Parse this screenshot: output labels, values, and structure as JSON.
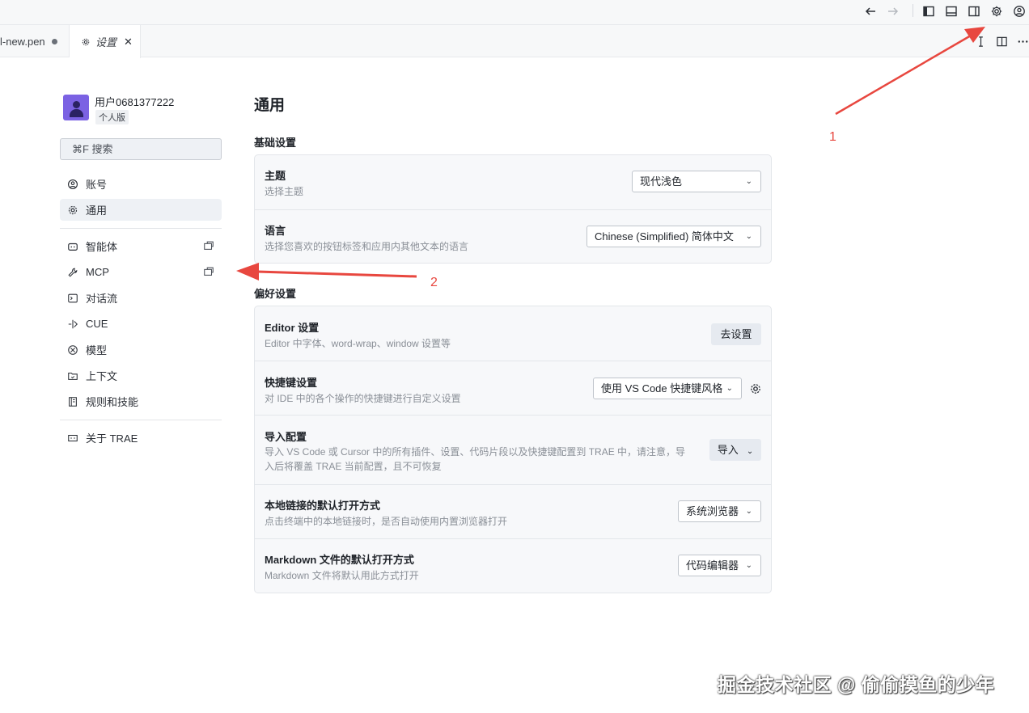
{
  "tabs": {
    "inactive_label": "l-new.pen",
    "active_label": "设置",
    "close_glyph": "✕"
  },
  "sidebar": {
    "username": "用户0681377222",
    "plan": "个人版",
    "search_label": "⌘F 搜索",
    "items": [
      {
        "label": "账号",
        "icon": "account-circle-icon"
      },
      {
        "label": "通用",
        "icon": "gear-icon"
      },
      {
        "label": "智能体",
        "icon": "agent-icon"
      },
      {
        "label": "MCP",
        "icon": "wrench-icon"
      },
      {
        "label": "对话流",
        "icon": "chat-flow-icon"
      },
      {
        "label": "CUE",
        "icon": "cue-icon"
      },
      {
        "label": "模型",
        "icon": "model-icon"
      },
      {
        "label": "上下文",
        "icon": "context-folder-icon"
      },
      {
        "label": "规则和技能",
        "icon": "rules-book-icon"
      },
      {
        "label": "关于 TRAE",
        "icon": "about-icon"
      }
    ]
  },
  "main": {
    "title": "通用",
    "basic": {
      "heading": "基础设置",
      "theme": {
        "title": "主题",
        "desc": "选择主题",
        "value": "现代浅色"
      },
      "language": {
        "title": "语言",
        "desc": "选择您喜欢的按钮标签和应用内其他文本的语言",
        "value": "Chinese (Simplified) 简体中文"
      }
    },
    "prefs": {
      "heading": "偏好设置",
      "editor": {
        "title": "Editor 设置",
        "desc": "Editor 中字体、word-wrap、window 设置等",
        "button": "去设置"
      },
      "shortcut": {
        "title": "快捷键设置",
        "desc": "对 IDE 中的各个操作的快捷键进行自定义设置",
        "value": "使用 VS Code 快捷键风格"
      },
      "import": {
        "title": "导入配置",
        "desc_line1": "导入 VS Code 或 Cursor 中的所有插件、设置、代码片段以及快捷键配置到 TRAE 中，请注意，导",
        "desc_line2": "入后将覆盖 TRAE 当前配置，且不可恢复",
        "button": "导入"
      },
      "local_link": {
        "title": "本地链接的默认打开方式",
        "desc": "点击终端中的本地链接时，是否自动使用内置浏览器打开",
        "value": "系统浏览器"
      },
      "markdown": {
        "title": "Markdown 文件的默认打开方式",
        "desc": "Markdown 文件将默认用此方式打开",
        "value": "代码编辑器"
      }
    }
  },
  "annotations": {
    "label_1": "1",
    "label_2": "2",
    "color": "#e8473f"
  },
  "watermark": "掘金技术社区 @ 偷偷摸鱼的少年",
  "colors": {
    "accent": "#7b62e3",
    "selected_bg": "#eef1f5",
    "card_bg": "#f7f8fa"
  }
}
